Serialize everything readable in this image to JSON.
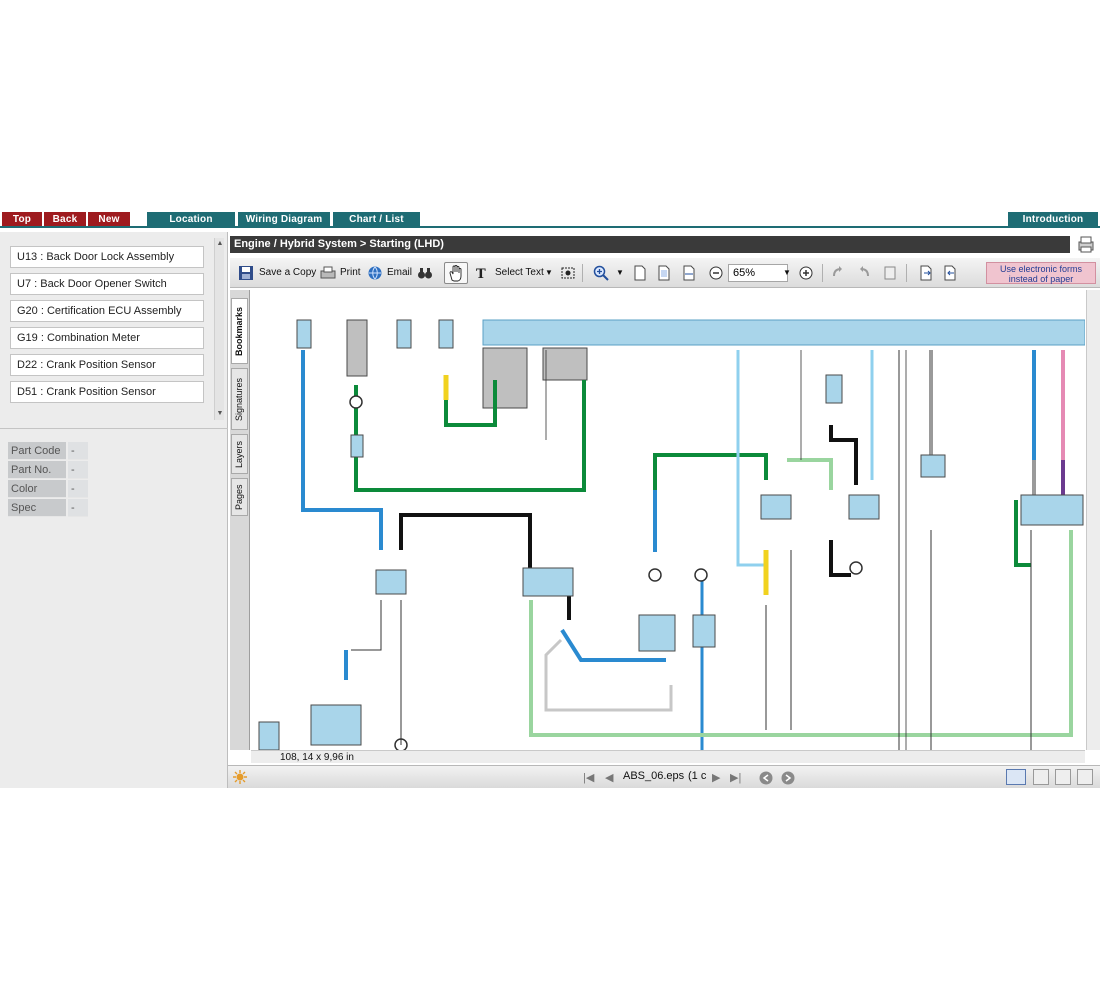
{
  "nav": {
    "top": "Top",
    "back": "Back",
    "new": "New",
    "location": "Location",
    "wiring": "Wiring Diagram",
    "chart": "Chart / List",
    "intro": "Introduction"
  },
  "list": [
    "U13 : Back Door Lock Assembly",
    "U7 : Back Door Opener Switch",
    "G20 : Certification ECU Assembly",
    "G19 : Combination Meter",
    "D22 : Crank Position Sensor",
    "D51 : Crank Position Sensor"
  ],
  "props": [
    {
      "key": "Part Code",
      "val": "-"
    },
    {
      "key": "Part No.",
      "val": "-"
    },
    {
      "key": "Color",
      "val": "-"
    },
    {
      "key": "Spec",
      "val": "-"
    }
  ],
  "breadcrumb": "Engine / Hybrid System > Starting (LHD)",
  "toolbar": {
    "save": "Save a Copy",
    "print": "Print",
    "email": "Email",
    "select_text": "Select Text",
    "zoom": "65%",
    "use_forms_1": "Use electronic forms",
    "use_forms_2": "instead of paper"
  },
  "sidetabs": [
    "Bookmarks",
    "Signatures",
    "Layers",
    "Pages"
  ],
  "size_label": "108, 14 x 9,96 in",
  "status": {
    "file": "ABS_06.eps",
    "page": "(1 c"
  },
  "colors": {
    "red": "#9e1b1f",
    "teal": "#1e6c74"
  }
}
